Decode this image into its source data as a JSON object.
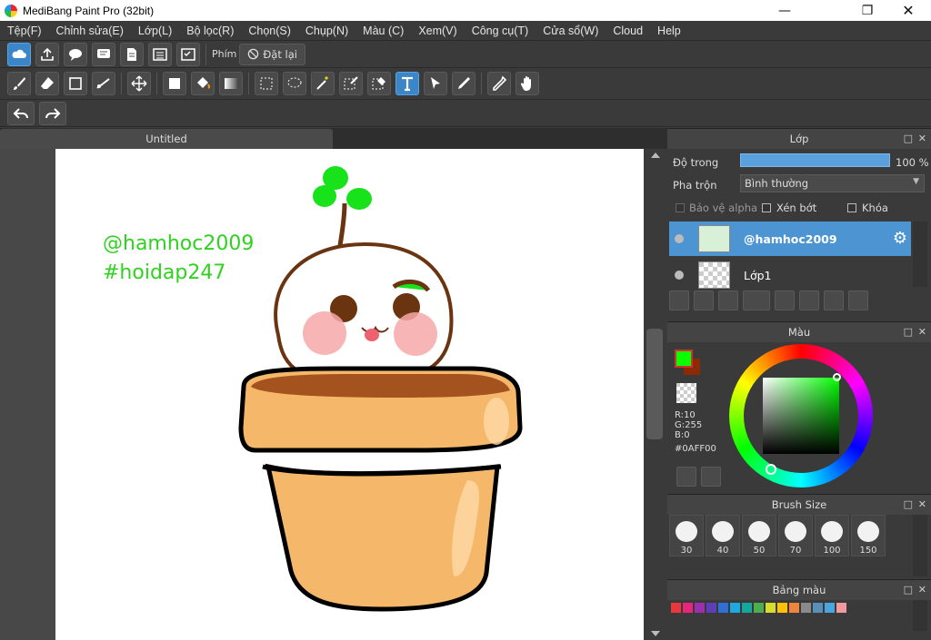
{
  "window": {
    "title": "MediBang Paint Pro (32bit)"
  },
  "menu": [
    "Tệp(F)",
    "Chỉnh sửa(E)",
    "Lớp(L)",
    "Bộ lọc(R)",
    "Chọn(S)",
    "Chụp(N)",
    "Màu (C)",
    "Xem(V)",
    "Công cụ(T)",
    "Cửa sổ(W)",
    "Cloud",
    "Help"
  ],
  "toolbar1": {
    "icons": [
      "cloud-icon",
      "upload-icon",
      "chat-icon",
      "comment-icon",
      "page-icon",
      "list-icon",
      "checklist-icon"
    ],
    "phim_label": "Phím",
    "reset_label": "Đặt lại"
  },
  "toolbar2": {
    "icons": [
      "brush-icon",
      "eraser-icon",
      "rectangle-icon",
      "line-icon",
      "move-icon",
      "fill-rect-icon",
      "bucket-icon",
      "gradient-icon",
      "select-rect-icon",
      "lasso-icon",
      "magic-wand-icon",
      "select-pen-icon",
      "select-eraser-icon",
      "text-icon",
      "operation-icon",
      "pen-icon",
      "eyedropper-icon",
      "hand-icon"
    ],
    "active": "text-icon"
  },
  "toolbar3": {
    "icons": [
      "undo-icon",
      "redo-icon"
    ]
  },
  "document": {
    "tab_title": "Untitled"
  },
  "canvas": {
    "watermark_lines": [
      "@hamhoc2009",
      "#hoidap247"
    ],
    "watermark_color": "#2fd21f"
  },
  "layers_panel": {
    "title": "Lớp",
    "opacity_label": "Độ trong",
    "opacity_value": "100 %",
    "opacity_fraction": 1.0,
    "blend_label": "Pha trộn",
    "blend_value": "Bình thường",
    "protect_alpha": "Bảo vệ alpha",
    "clipping": "Xén bớt",
    "lock": "Khóa",
    "layers": [
      {
        "name": "@hamhoc2009",
        "selected": true
      },
      {
        "name": "Lớp1",
        "selected": false
      }
    ]
  },
  "color_panel": {
    "title": "Màu",
    "fg_color": "#0AFF00",
    "bg_color": "#8B2A05",
    "rgb_r": "R:10",
    "rgb_g": "G:255",
    "rgb_b": "B:0",
    "hex": "#0AFF00"
  },
  "brush_size_panel": {
    "title": "Brush Size",
    "sizes": [
      "30",
      "40",
      "50",
      "70",
      "100",
      "150"
    ]
  },
  "palette_panel": {
    "title": "Bảng màu",
    "colors": [
      "#e8383d",
      "#e5267a",
      "#9b2fae",
      "#5b3eb8",
      "#2f6fd6",
      "#1ea8e2",
      "#13a89e",
      "#4cae4f",
      "#d6de2b",
      "#ffc107",
      "#f0843c",
      "#8a8a8a",
      "#5a8fb8",
      "#4aa6e0",
      "#f09aa0"
    ]
  }
}
